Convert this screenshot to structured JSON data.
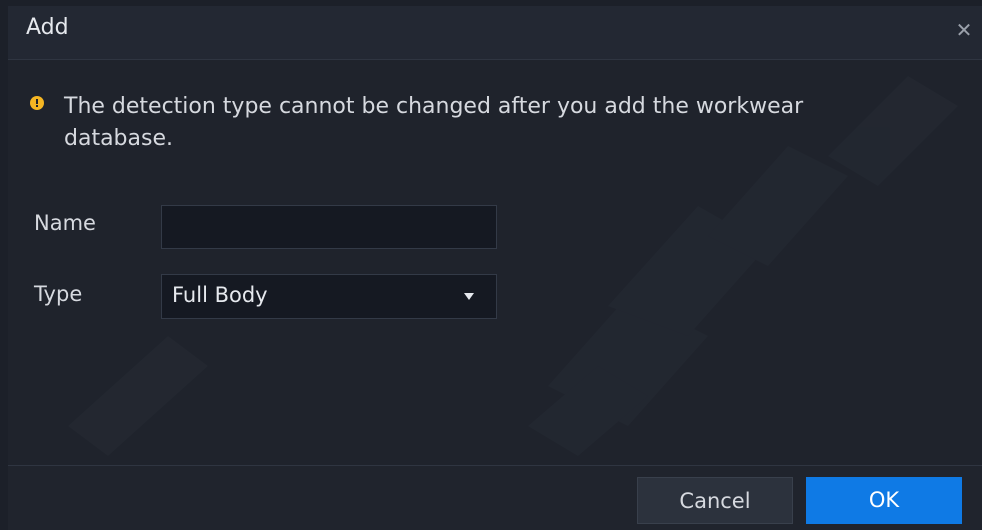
{
  "dialog": {
    "title": "Add",
    "close_icon": "close-icon",
    "notice": {
      "icon": "warning-icon",
      "icon_color": "#f5b623",
      "text": "The detection type cannot be changed after you add the workwear database."
    }
  },
  "form": {
    "name_label": "Name",
    "name_value": "",
    "name_placeholder": "",
    "type_label": "Type",
    "type_value": "Full Body"
  },
  "footer": {
    "cancel_label": "Cancel",
    "ok_label": "OK",
    "ok_color": "#0f7ae5"
  }
}
